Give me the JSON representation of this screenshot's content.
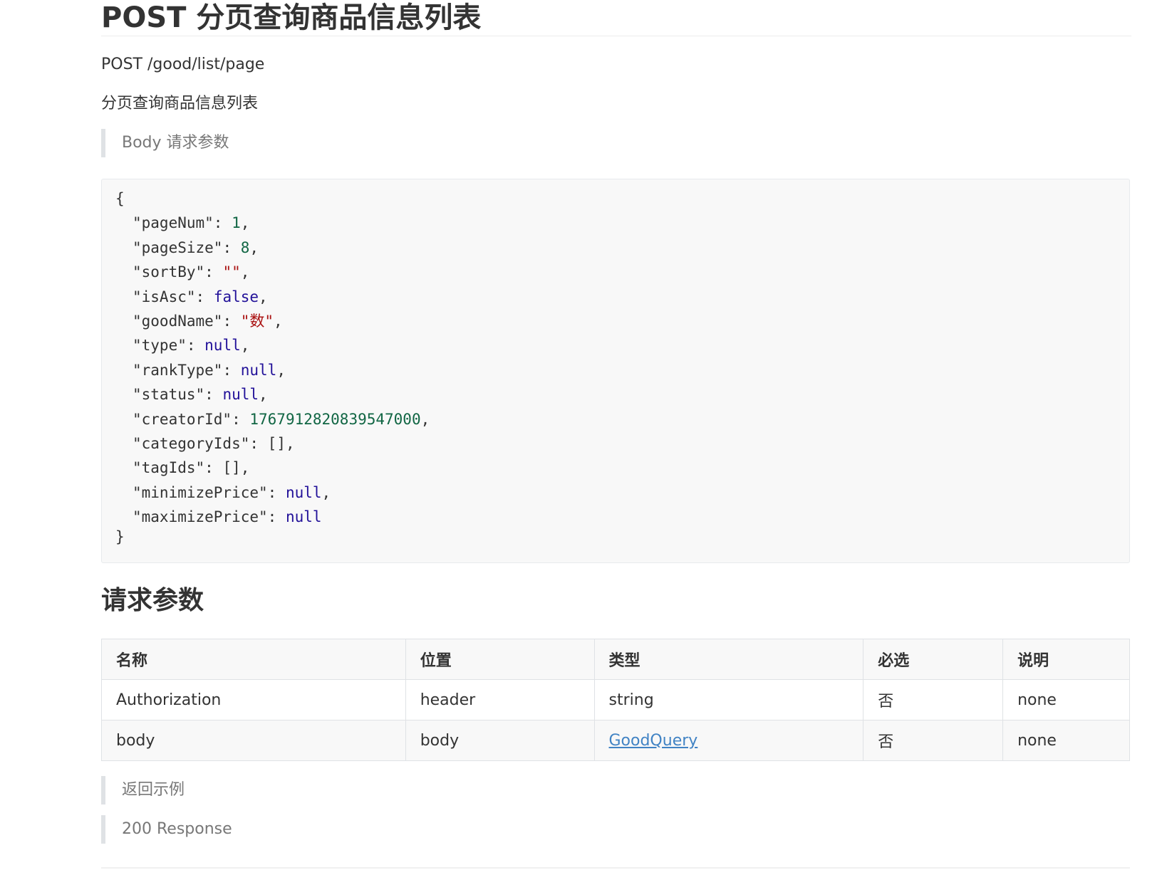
{
  "title": "POST 分页查询商品信息列表",
  "endpoint": "POST /good/list/page",
  "description": "分页查询商品信息列表",
  "body_params_label": "Body 请求参数",
  "code": {
    "open_brace": "{",
    "close_brace": "}",
    "lines": [
      {
        "key": "\"pageNum\"",
        "sep": ": ",
        "value": "1",
        "kind": "num",
        "trail": ","
      },
      {
        "key": "\"pageSize\"",
        "sep": ": ",
        "value": "8",
        "kind": "num",
        "trail": ","
      },
      {
        "key": "\"sortBy\"",
        "sep": ": ",
        "value": "\"\"",
        "kind": "str",
        "trail": ","
      },
      {
        "key": "\"isAsc\"",
        "sep": ": ",
        "value": "false",
        "kind": "kw",
        "trail": ","
      },
      {
        "key": "\"goodName\"",
        "sep": ": ",
        "value": "\"数\"",
        "kind": "str",
        "trail": ","
      },
      {
        "key": "\"type\"",
        "sep": ": ",
        "value": "null",
        "kind": "kw",
        "trail": ","
      },
      {
        "key": "\"rankType\"",
        "sep": ": ",
        "value": "null",
        "kind": "kw",
        "trail": ","
      },
      {
        "key": "\"status\"",
        "sep": ": ",
        "value": "null",
        "kind": "kw",
        "trail": ","
      },
      {
        "key": "\"creatorId\"",
        "sep": ": ",
        "value": "1767912820839547000",
        "kind": "num",
        "trail": ","
      },
      {
        "key": "\"categoryIds\"",
        "sep": ": ",
        "value": "[]",
        "kind": "punc",
        "trail": ","
      },
      {
        "key": "\"tagIds\"",
        "sep": ": ",
        "value": "[]",
        "kind": "punc",
        "trail": ","
      },
      {
        "key": "\"minimizePrice\"",
        "sep": ": ",
        "value": "null",
        "kind": "kw",
        "trail": ","
      },
      {
        "key": "\"maximizePrice\"",
        "sep": ": ",
        "value": "null",
        "kind": "kw",
        "trail": ""
      }
    ]
  },
  "request_params_heading": "请求参数",
  "table": {
    "headers": [
      "名称",
      "位置",
      "类型",
      "必选",
      "说明"
    ],
    "rows": [
      {
        "name": "Authorization",
        "location": "header",
        "type": "string",
        "required": "否",
        "desc": "none"
      },
      {
        "name": "body",
        "location": "body",
        "type": "GoodQuery",
        "required": "否",
        "desc": "none"
      }
    ]
  },
  "return_example_label": "返回示例",
  "response_label": "200 Response",
  "colors": {
    "number": "#116644",
    "string": "#aa1111",
    "keyword": "#221199",
    "link": "#4183c4"
  }
}
